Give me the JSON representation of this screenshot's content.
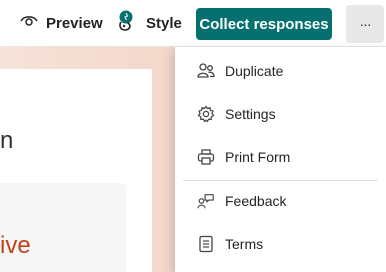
{
  "toolbar": {
    "preview_label": "Preview",
    "style_label": "Style",
    "collect_label": "Collect responses",
    "more_label": "···"
  },
  "background": {
    "card_text": "n",
    "inner_text": "ive"
  },
  "menu": {
    "items": [
      {
        "label": "Duplicate",
        "icon": "duplicate-icon"
      },
      {
        "label": "Settings",
        "icon": "gear-icon"
      },
      {
        "label": "Print Form",
        "icon": "printer-icon"
      },
      {
        "label": "Feedback",
        "icon": "feedback-icon"
      },
      {
        "label": "Terms",
        "icon": "document-icon"
      }
    ]
  },
  "colors": {
    "accent": "#05706f",
    "inner_text": "#c0421c"
  }
}
